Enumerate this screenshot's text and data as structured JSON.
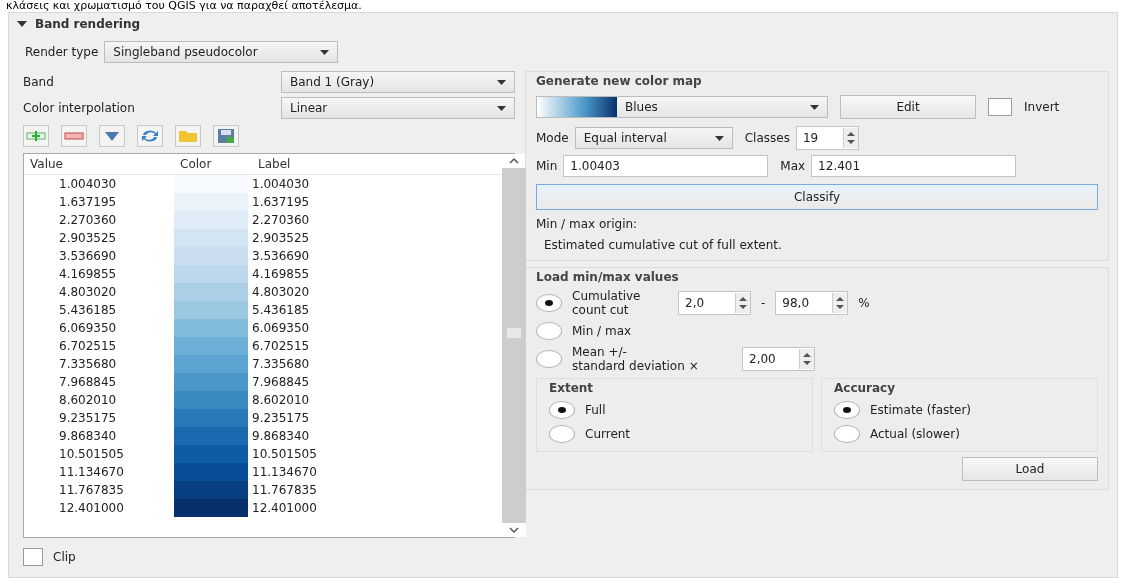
{
  "caption": "κλάσεις και χρωματισμό του QGIS για να παραχθεί αποτέλεσμα.",
  "section": {
    "title": "Band rendering",
    "expanded": true
  },
  "render_type": {
    "label": "Render type",
    "value": "Singleband pseudocolor"
  },
  "band": {
    "label": "Band",
    "value": "Band 1 (Gray)"
  },
  "interpolation": {
    "label": "Color interpolation",
    "value": "Linear"
  },
  "table": {
    "columns": [
      "Value",
      "Color",
      "Label"
    ],
    "rows": [
      {
        "value": "1.004030",
        "color": "#f7fbff",
        "label": "1.004030"
      },
      {
        "value": "1.637195",
        "color": "#ebf3fb",
        "label": "1.637195"
      },
      {
        "value": "2.270360",
        "color": "#e0ecf8",
        "label": "2.270360"
      },
      {
        "value": "2.903525",
        "color": "#d3e4f3",
        "label": "2.903525"
      },
      {
        "value": "3.536690",
        "color": "#cadef0",
        "label": "3.536690"
      },
      {
        "value": "4.169855",
        "color": "#bdd7ec",
        "label": "4.169855"
      },
      {
        "value": "4.803020",
        "color": "#abd0e6",
        "label": "4.803020"
      },
      {
        "value": "5.436185",
        "color": "#9ac8e0",
        "label": "5.436185"
      },
      {
        "value": "6.069350",
        "color": "#82badb",
        "label": "6.069350"
      },
      {
        "value": "6.702515",
        "color": "#6baed6",
        "label": "6.702515"
      },
      {
        "value": "7.335680",
        "color": "#5ba3d0",
        "label": "7.335680"
      },
      {
        "value": "7.968845",
        "color": "#4a98c9",
        "label": "7.968845"
      },
      {
        "value": "8.602010",
        "color": "#3a8ac2",
        "label": "8.602010"
      },
      {
        "value": "9.235175",
        "color": "#2979b9",
        "label": "9.235175"
      },
      {
        "value": "9.868340",
        "color": "#1b6aaf",
        "label": "9.868340"
      },
      {
        "value": "10.501505",
        "color": "#105ca4",
        "label": "10.501505"
      },
      {
        "value": "11.134670",
        "color": "#084d97",
        "label": "11.134670"
      },
      {
        "value": "11.767835",
        "color": "#083f81",
        "label": "11.767835"
      },
      {
        "value": "12.401000",
        "color": "#08306b",
        "label": "12.401000"
      }
    ]
  },
  "clip": {
    "label": "Clip",
    "checked": false
  },
  "color_map": {
    "title": "Generate new color map",
    "ramp": "Blues",
    "edit": "Edit",
    "invert": {
      "label": "Invert",
      "checked": false
    },
    "mode_label": "Mode",
    "mode": "Equal interval",
    "classes_label": "Classes",
    "classes": "19",
    "min_label": "Min",
    "min": "1.00403",
    "max_label": "Max",
    "max": "12.401",
    "classify": "Classify",
    "origin_label": "Min / max origin:",
    "origin": "Estimated cumulative cut of full extent."
  },
  "minmax": {
    "title": "Load min/max values",
    "options": [
      {
        "kind": "range",
        "label": "Cumulative count cut",
        "selected": true,
        "from": "2,0",
        "separator": "-",
        "to": "98,0",
        "unit": "%"
      },
      {
        "kind": "plain",
        "label": "Min / max",
        "selected": false
      },
      {
        "kind": "factor",
        "label": "Mean +/-\nstandard deviation ×",
        "selected": false,
        "factor": "2,00"
      }
    ],
    "extent": {
      "title": "Extent",
      "options": [
        {
          "label": "Full",
          "selected": true
        },
        {
          "label": "Current",
          "selected": false
        }
      ]
    },
    "accuracy": {
      "title": "Accuracy",
      "options": [
        {
          "label": "Estimate (faster)",
          "selected": true
        },
        {
          "label": "Actual (slower)",
          "selected": false
        }
      ]
    },
    "load": "Load"
  }
}
